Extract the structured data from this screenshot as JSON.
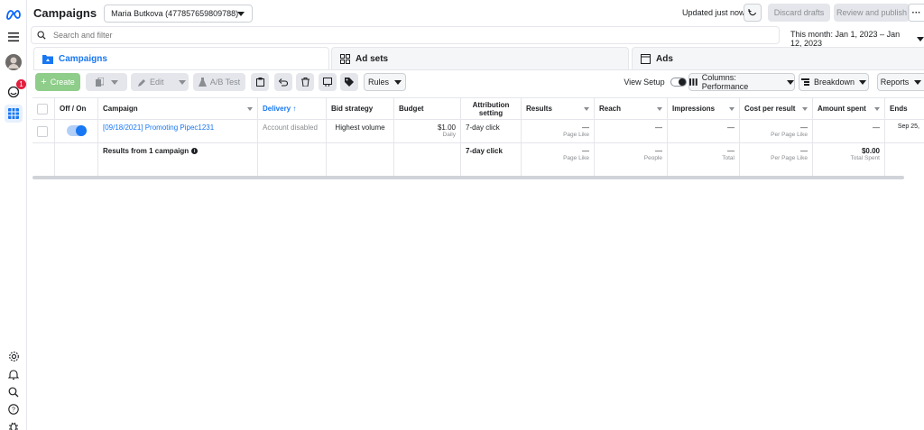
{
  "header": {
    "title": "Campaigns",
    "account": "Maria Butkova (477857659809788)",
    "updated": "Updated just now",
    "discard_label": "Discard drafts",
    "review_label": "Review and publish",
    "more_label": "···"
  },
  "search": {
    "placeholder": "Search and filter",
    "date_range": "This month: Jan 1, 2023 – Jan 12, 2023"
  },
  "rail": {
    "notification_count": "1"
  },
  "tabs": [
    {
      "label": "Campaigns"
    },
    {
      "label": "Ad sets"
    },
    {
      "label": "Ads"
    }
  ],
  "toolbar": {
    "create_label": "Create",
    "edit_label": "Edit",
    "ab_label": "A/B Test",
    "rules_label": "Rules",
    "view_setup_label": "View Setup",
    "columns_label": "Columns: Performance",
    "breakdown_label": "Breakdown",
    "reports_label": "Reports"
  },
  "table": {
    "headers": {
      "off_on": "Off / On",
      "campaign": "Campaign",
      "delivery": "Delivery ↑",
      "bid_strategy": "Bid strategy",
      "budget": "Budget",
      "attribution": "Attribution setting",
      "results": "Results",
      "reach": "Reach",
      "impressions": "Impressions",
      "cost_per_result": "Cost per result",
      "amount_spent": "Amount spent",
      "ends": "Ends"
    },
    "row": {
      "campaign": "[09/18/2021] Promoting Pipec1231",
      "delivery": "Account disabled",
      "bid_strategy": "Highest volume",
      "budget": "$1.00",
      "budget_sub": "Daily",
      "attribution": "7-day click",
      "results": "—",
      "results_sub": "Page Like",
      "reach": "—",
      "impressions": "—",
      "cost_per_result": "—",
      "cost_sub": "Per Page Like",
      "amount_spent": "—",
      "ends": "Sep 25,"
    },
    "summary": {
      "label": "Results from 1 campaign",
      "attribution": "7-day click",
      "results": "—",
      "results_sub": "Page Like",
      "reach": "—",
      "reach_sub": "People",
      "impressions": "—",
      "impressions_sub": "Total",
      "cost_per_result": "—",
      "cost_sub": "Per Page Like",
      "amount_spent": "$0.00",
      "amount_sub": "Total Spent"
    }
  }
}
